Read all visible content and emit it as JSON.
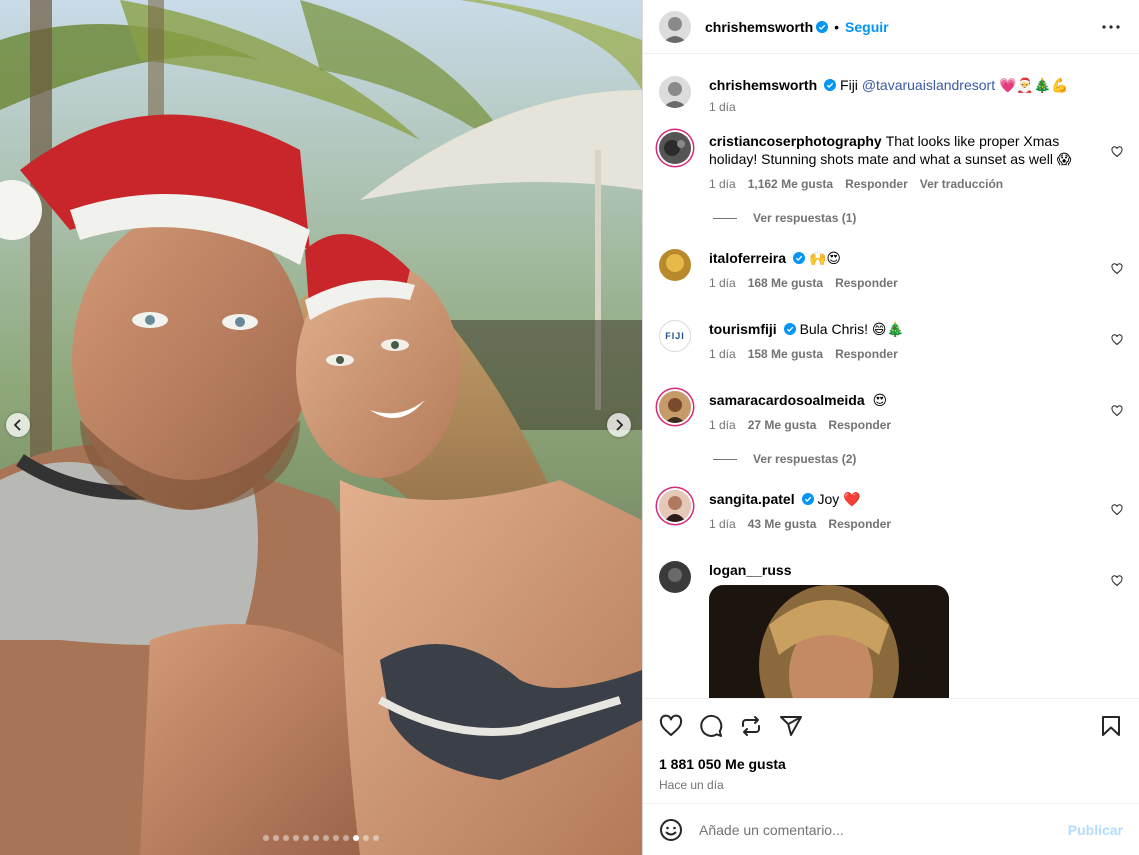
{
  "post": {
    "author": "chrishemsworth",
    "follow_label": "Seguir",
    "separator": "•",
    "caption": "Fiji",
    "caption_mention": "@tavaruaislandresort",
    "caption_emojis": "💗🎅🎄💪",
    "caption_time": "1 día",
    "likes": "1 881 050 Me gusta",
    "posted": "Hace un día",
    "carousel": {
      "total": 12,
      "active_index": 9
    }
  },
  "comments": [
    {
      "user": "cristiancoserphotography",
      "verified": false,
      "text": "That looks like proper Xmas holiday! Stunning shots mate and what a sunset as well 😱",
      "time": "1 día",
      "likes": "1,162 Me gusta",
      "reply": "Responder",
      "translate": "Ver traducción",
      "replies": "Ver respuestas (1)"
    },
    {
      "user": "italoferreira",
      "verified": true,
      "text": "🙌😍",
      "time": "1 día",
      "likes": "168 Me gusta",
      "reply": "Responder"
    },
    {
      "user": "tourismfiji",
      "verified": true,
      "text": "Bula Chris! 😄🎄",
      "time": "1 día",
      "likes": "158 Me gusta",
      "reply": "Responder",
      "avatar_text": "FIJI"
    },
    {
      "user": "samaracardosoalmeida",
      "verified": false,
      "text": "😍",
      "time": "1 día",
      "likes": "27 Me gusta",
      "reply": "Responder",
      "replies": "Ver respuestas (2)"
    },
    {
      "user": "sangita.patel",
      "verified": true,
      "text": "Joy ❤️",
      "time": "1 día",
      "likes": "43 Me gusta",
      "reply": "Responder"
    },
    {
      "user": "logan__russ",
      "verified": false,
      "text": ""
    }
  ],
  "add_comment": {
    "placeholder": "Añade un comentario...",
    "publish": "Publicar"
  },
  "colors": {
    "accent": "#0095f6",
    "verified": "#0095f6",
    "muted": "#737373",
    "publish_disabled": "#b3dbff",
    "mention": "#3958a5"
  },
  "icons": [
    "more-options-icon",
    "heart-icon",
    "comment-icon",
    "repost-icon",
    "share-icon",
    "bookmark-icon",
    "emoji-icon",
    "chevron-left-icon",
    "chevron-right-icon",
    "verified-badge-icon"
  ]
}
